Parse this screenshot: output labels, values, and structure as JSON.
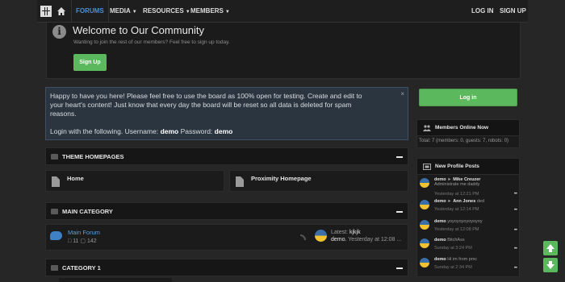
{
  "nav": {
    "logo_icon": "grid-logo-icon",
    "home_icon": "home-icon",
    "items": [
      {
        "label": "FORUMS",
        "active": true
      },
      {
        "label": "MEDIA",
        "dropdown": true
      },
      {
        "label": "RESOURCES",
        "dropdown": true
      },
      {
        "label": "MEMBERS",
        "dropdown": true
      }
    ],
    "login": "LOG IN",
    "signup": "SIGN UP"
  },
  "welcome": {
    "title": "Welcome to Our Community",
    "subtitle": "Wanting to join the rest of our members? Feel free to sign up today.",
    "button": "Sign Up",
    "icon": "info-icon"
  },
  "notice": {
    "line1": "Happy to have you here! Please feel free to use the board as 100% open for testing. Create and edit to",
    "line2": "your heart's content! Just know that every day the board will be reset so all data is deleted for spam",
    "line3": "reasons.",
    "login_prefix": "Login with the following. Username:",
    "username": "demo",
    "password_label": "Password:",
    "password": "demo",
    "close": "×"
  },
  "sections": {
    "theme": {
      "title": "THEME HOMEPAGES",
      "cards": [
        "Home",
        "Proximity Homepage"
      ]
    },
    "main": {
      "title": "MAIN CATEGORY",
      "forum": {
        "name": "Main Forum",
        "threads": "11",
        "messages": "142",
        "latest_label": "Latest:",
        "latest_title": "kjkjk",
        "latest_user": "demo",
        "latest_time": "Yesterday at 12:08 ..."
      }
    },
    "cat1": {
      "title": "CATEGORY 1"
    }
  },
  "sidebar": {
    "login_button": "Log in",
    "members_title": "Members Online Now",
    "members_text": "Total: 7 (members: 0, guests: 7, robots: 0)",
    "profile_title": "New Profile Posts",
    "posts": [
      {
        "user": "demo",
        "arrow": "►",
        "target": "Mike Creuzer",
        "text": "Administrate me daddy",
        "time": "Yesterday at 12:21 PM"
      },
      {
        "user": "demo",
        "arrow": "►",
        "target": "Ann Jones",
        "text": "ded",
        "time": "Yesterday at 12:14 PM"
      },
      {
        "user": "demo",
        "arrow": "",
        "target": "",
        "text": "yoyoyoyoyoyoyoy",
        "time": "Yesterday at 12:08 PM"
      },
      {
        "user": "demo",
        "arrow": "",
        "target": "",
        "text": "BitchAss",
        "time": "Sunday at 3:24 PM"
      },
      {
        "user": "demo",
        "arrow": "",
        "target": "",
        "text": "Hi im from pmc",
        "time": "Sunday at 2:34 PM"
      }
    ]
  },
  "scroll": {
    "up_icon": "arrow-up-icon",
    "down_icon": "arrow-down-icon"
  },
  "colors": {
    "accent": "#5cb85c",
    "link": "#4a90d9",
    "notice_bg": "#2b3540"
  }
}
